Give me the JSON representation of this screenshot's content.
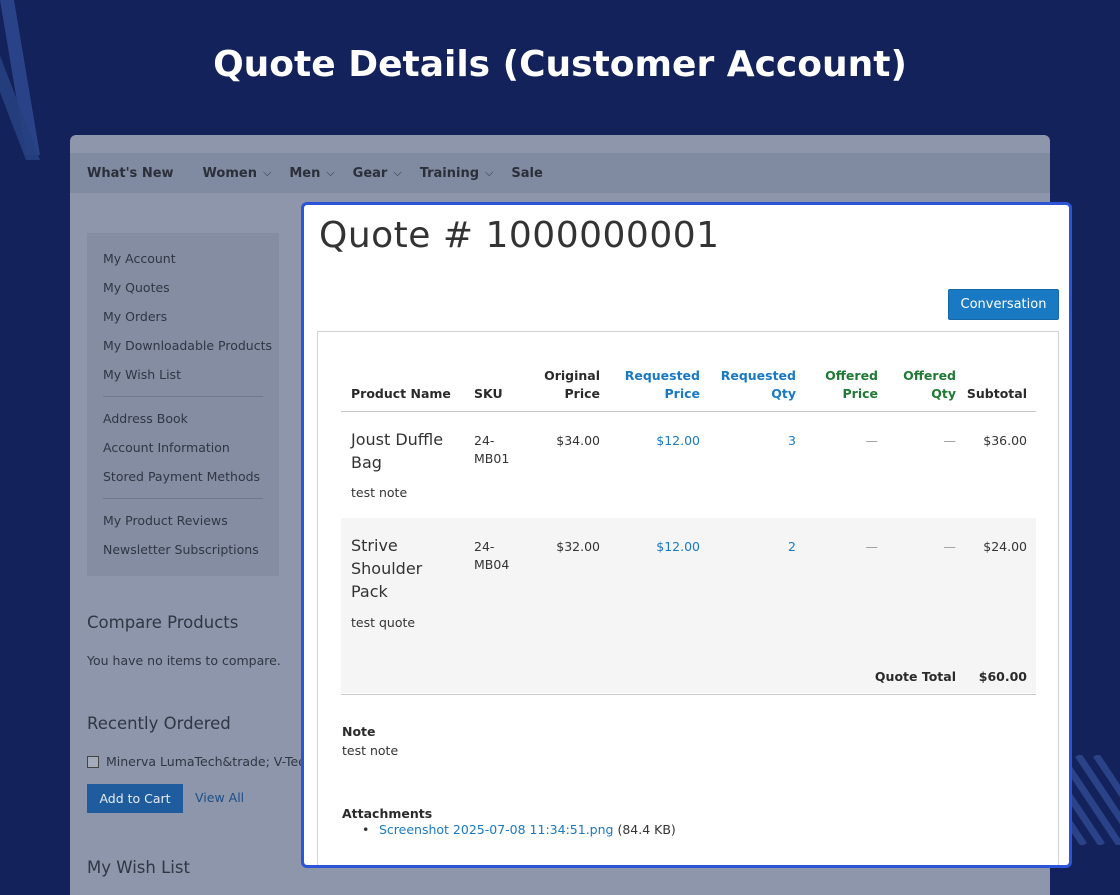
{
  "headline": "Quote Details (Customer Account)",
  "nav": {
    "items": [
      {
        "label": "What's New",
        "dropdown": false
      },
      {
        "label": "Women",
        "dropdown": true
      },
      {
        "label": "Men",
        "dropdown": true
      },
      {
        "label": "Gear",
        "dropdown": true
      },
      {
        "label": "Training",
        "dropdown": true
      },
      {
        "label": "Sale",
        "dropdown": false
      }
    ]
  },
  "sidebar": {
    "items": [
      "My Account",
      "My Quotes",
      "My Orders",
      "My Downloadable Products",
      "My Wish List",
      "Address Book",
      "Account Information",
      "Stored Payment Methods",
      "My Product Reviews",
      "Newsletter Subscriptions"
    ]
  },
  "compare": {
    "title": "Compare Products",
    "empty_text": "You have no items to compare."
  },
  "recently_ordered": {
    "title": "Recently Ordered",
    "item": "Minerva LumaTech&trade; V-Tee",
    "add_to_cart": "Add to Cart",
    "view_all": "View All"
  },
  "wishlist": {
    "title": "My Wish List"
  },
  "quote": {
    "title": "Quote # 1000000001",
    "conversation_button": "Conversation",
    "columns": {
      "product_name": "Product Name",
      "sku": "SKU",
      "original_price": [
        "Original",
        "Price"
      ],
      "requested_price": [
        "Requested",
        "Price"
      ],
      "requested_qty": [
        "Requested",
        "Qty"
      ],
      "offered_price": [
        "Offered",
        "Price"
      ],
      "offered_qty": [
        "Offered",
        "Qty"
      ],
      "subtotal": "Subtotal"
    },
    "rows": [
      {
        "name_lines": [
          "Joust Duffle",
          "Bag"
        ],
        "note": "test note",
        "sku_lines": [
          "24-",
          "MB01"
        ],
        "original_price": "$34.00",
        "requested_price": "$12.00",
        "requested_qty": "3",
        "offered_price": "—",
        "offered_qty": "—",
        "subtotal": "$36.00"
      },
      {
        "name_lines": [
          "Strive",
          "Shoulder",
          "Pack"
        ],
        "note": "test quote",
        "sku_lines": [
          "24-",
          "MB04"
        ],
        "original_price": "$32.00",
        "requested_price": "$12.00",
        "requested_qty": "2",
        "offered_price": "—",
        "offered_qty": "—",
        "subtotal": "$24.00"
      }
    ],
    "total_label": "Quote Total",
    "total_value": "$60.00",
    "note_label": "Note",
    "note_text": "test note",
    "attachments_label": "Attachments",
    "attachment": {
      "name": "Screenshot 2025-07-08 11:34:51.png",
      "size": "(84.4 KB)"
    }
  },
  "colors": {
    "background": "#13225a",
    "panel_border": "#2b55d6",
    "button_blue": "#1979c3",
    "requested_blue": "#1979c3",
    "offered_green": "#1f7a33"
  }
}
